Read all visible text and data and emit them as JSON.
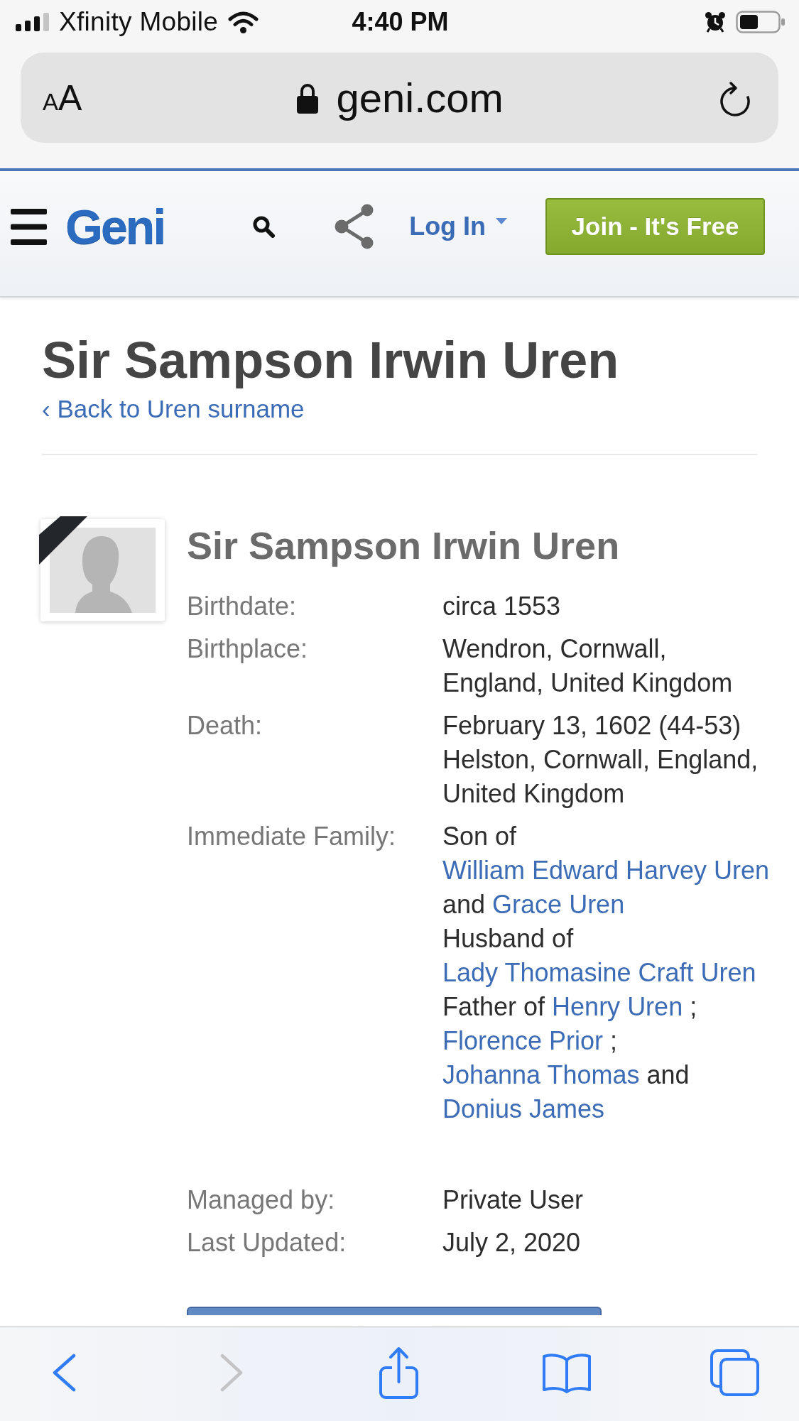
{
  "status_bar": {
    "carrier": "Xfinity Mobile",
    "time": "4:40 PM"
  },
  "address_bar": {
    "text_size_button": "AA",
    "domain": "geni.com"
  },
  "site_header": {
    "logo": "Geni",
    "login_link": "Log In",
    "join_button": "Join - It's Free"
  },
  "page": {
    "title": "Sir Sampson Irwin Uren",
    "back_link": "‹ Back to Uren surname"
  },
  "profile": {
    "deceased": true,
    "name": "Sir Sampson Irwin Uren",
    "facts": [
      {
        "kind": "lines",
        "label": "Birthdate:",
        "values": [
          "circa 1553"
        ]
      },
      {
        "kind": "lines",
        "label": "Birthplace:",
        "values": [
          "Wendron, Cornwall, England, United Kingdom"
        ]
      },
      {
        "kind": "lines",
        "label": "Death:",
        "values": [
          "February 13, 1602 (44-53)",
          "Helston, Cornwall, England, United Kingdom"
        ]
      },
      {
        "kind": "family",
        "label": "Immediate Family:",
        "relations": [
          {
            "parts": [
              {
                "kind": "text",
                "text": "Son of"
              },
              {
                "kind": "link",
                "text": "William Edward Harvey Uren"
              },
              {
                "kind": "text",
                "text": "and"
              },
              {
                "kind": "link",
                "text": "Grace Uren"
              }
            ]
          },
          {
            "parts": [
              {
                "kind": "text",
                "text": "Husband of"
              },
              {
                "kind": "link",
                "text": "Lady Thomasine Craft Uren"
              }
            ]
          },
          {
            "parts": [
              {
                "kind": "text",
                "text": "Father of"
              },
              {
                "kind": "link",
                "text": "Henry Uren"
              },
              {
                "kind": "text",
                "text": ";"
              },
              {
                "kind": "link",
                "text": "Florence Prior"
              },
              {
                "kind": "text",
                "text": ";"
              },
              {
                "kind": "link",
                "text": "Johanna Thomas"
              },
              {
                "kind": "text",
                "text": "and"
              },
              {
                "kind": "link",
                "text": "Donius James"
              }
            ]
          }
        ]
      }
    ],
    "management": [
      {
        "label": "Managed by:",
        "value": "Private User"
      },
      {
        "label": "Last Updated:",
        "value": "July 2, 2020"
      }
    ]
  },
  "browser_toolbar": {
    "buttons": [
      {
        "kind": "back",
        "disabled": false
      },
      {
        "kind": "forward",
        "disabled": true
      },
      {
        "kind": "share",
        "disabled": false
      },
      {
        "kind": "bookmarks",
        "disabled": false
      },
      {
        "kind": "tabs",
        "disabled": false
      }
    ]
  }
}
